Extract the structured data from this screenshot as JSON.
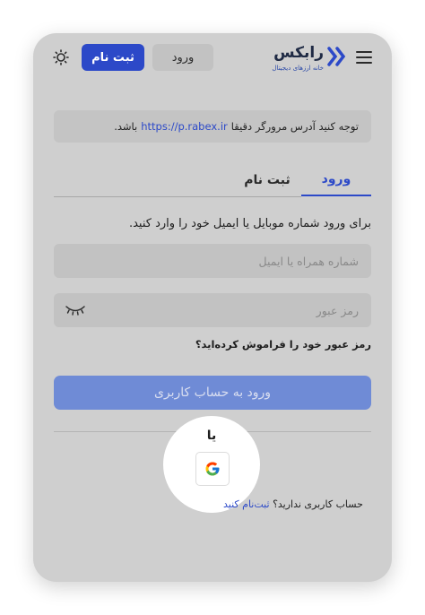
{
  "header": {
    "brand_name": "رابکس",
    "brand_tagline": "خانه ارزهای دیجیتال",
    "login_label": "ورود",
    "register_label": "ثبت نام",
    "menu_icon": "hamburger-menu-icon",
    "theme_icon": "sun-icon"
  },
  "notice": {
    "prefix": "توجه کنید آدرس مرورگر دقیقا",
    "url": "https://p.rabex.ir",
    "suffix": "باشد."
  },
  "tabs": [
    {
      "label": "ورود",
      "active": true
    },
    {
      "label": "ثبت نام",
      "active": false
    }
  ],
  "form": {
    "instruction": "برای ورود شماره موبایل یا ایمیل خود را وارد کنید.",
    "phone_placeholder": "شماره همراه یا ایمیل",
    "password_placeholder": "رمز عبور",
    "forgot_label": "رمز عبور خود را فراموش کرده‌اید؟",
    "submit_label": "ورود به حساب کاربری"
  },
  "alt_login": {
    "or_label": "یا",
    "google_icon": "google-icon"
  },
  "signup": {
    "question": "حساب کاربری ندارید؟",
    "link_label": "ثبت‌نام کنید"
  },
  "colors": {
    "accent": "#2c49c8",
    "submit_disabled": "#6f8bd6",
    "overlay_background": "#cfcfcf"
  }
}
